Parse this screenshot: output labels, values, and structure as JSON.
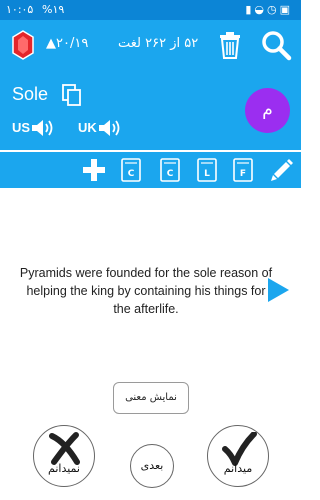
{
  "status_bar": {
    "time": "۱۰:۰۵",
    "battery": "%۱۹",
    "status_icons": [
      "signal-icon",
      "wifi-icon",
      "alarm-icon",
      "notification-icon"
    ]
  },
  "top_bar": {
    "score": "▲۲۰/۱۹",
    "progress": "۵۲ از ۲۶۲ لغت",
    "icons": [
      "ruby-gem-icon",
      "trash-icon",
      "search-icon"
    ]
  },
  "word_panel": {
    "word": "Sole",
    "us_label": "US",
    "uk_label": "UK",
    "avatar_letter": "م"
  },
  "tool_bar": {
    "card_labels": [
      "C",
      "C",
      "L",
      "F"
    ],
    "icons": [
      "plus-icon",
      "pencil-icon"
    ]
  },
  "content": {
    "sentence": "Pyramids were founded for the sole reason of helping the king by containing his things for the afterlife."
  },
  "buttons": {
    "show_meaning": "نمایش معنی",
    "dont_know": "نمیدانم",
    "next": "بعدی",
    "know": "میدانم"
  },
  "colors": {
    "status_bar": "#0c85d6",
    "primary": "#1ba6ee",
    "avatar": "#9b2ef0",
    "gem": "#e4262b"
  }
}
